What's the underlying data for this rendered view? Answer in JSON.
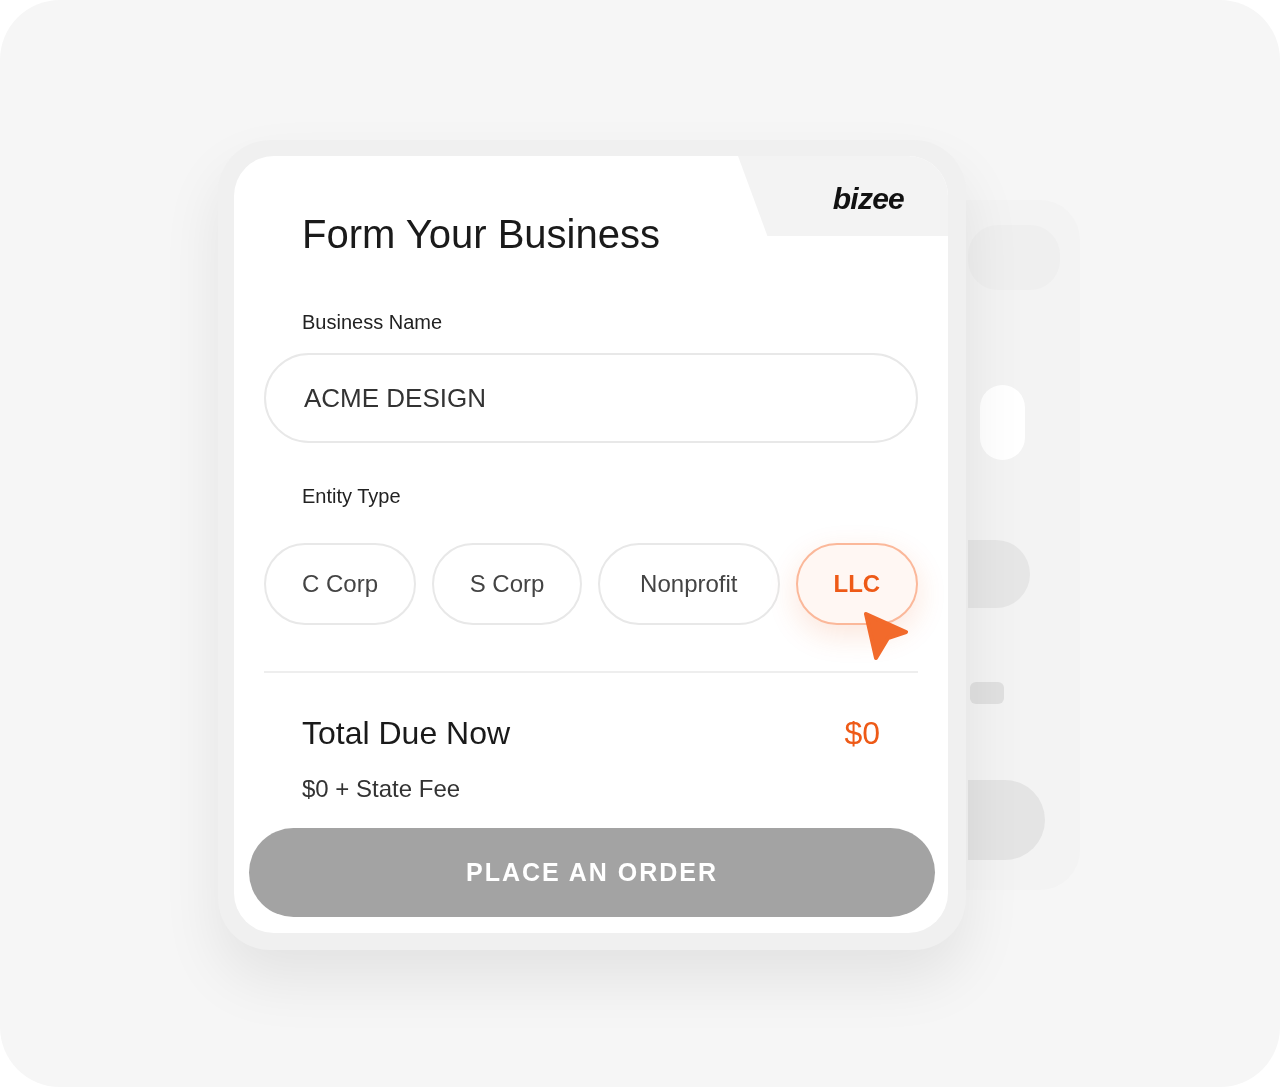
{
  "logo": "bizee",
  "title": "Form Your Business",
  "business_name": {
    "label": "Business Name",
    "value": "ACME DESIGN"
  },
  "entity_type": {
    "label": "Entity Type",
    "options": [
      {
        "label": "C Corp",
        "selected": false
      },
      {
        "label": "S Corp",
        "selected": false
      },
      {
        "label": "Nonprofit",
        "selected": false
      },
      {
        "label": "LLC",
        "selected": true
      }
    ]
  },
  "total": {
    "label": "Total Due Now",
    "amount": "$0",
    "note": "$0 + State Fee"
  },
  "order_button": {
    "label": "PLACE AN ORDER",
    "disabled": true
  }
}
